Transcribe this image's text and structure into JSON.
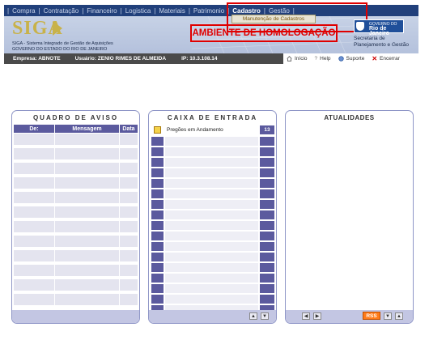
{
  "nav": {
    "items": [
      "Compra",
      "Contratação",
      "Financeiro",
      "Logistica",
      "Materiais",
      "Patrimonio",
      "Cadastro",
      "Gestão"
    ],
    "active_index": 6,
    "dropdown_item": "Manutenção de Cadastros"
  },
  "header": {
    "logo_text": "SIGA",
    "subtitle_line1": "SIGA - Sistema Integrado de Gestão de Aquisições",
    "subtitle_line2": "GOVERNO DO ESTADO DO RIO DE JANEIRO",
    "environment_banner": "AMBIENTE DE HOMOLOGAÇÃO",
    "gov_small": "GOVERNO DO",
    "gov_big": "Rio de Janeiro",
    "secretaria_line1": "Secretaria de",
    "secretaria_line2": "Planejamento e Gestão"
  },
  "userbar": {
    "empresa": "Empresa: ABNOTE",
    "usuario": "Usuário: ZENIO RIMES DE ALMEIDA",
    "ip": "IP: 10.3.108.14",
    "links": [
      "Início",
      "Help",
      "Suporte",
      "Encerrar"
    ]
  },
  "aviso": {
    "title": "QUADRO DE AVISO",
    "columns": [
      "De:",
      "Mensagem",
      "Data"
    ]
  },
  "caixa": {
    "title": "CAIXA DE ENTRADA",
    "first_item": "Pregões em Andamento",
    "first_count": "13"
  },
  "atualidades": {
    "title": "ATUALIDADES",
    "rss_label": "RSS"
  },
  "colors": {
    "nav_bg": "#21407b",
    "accent_purple": "#5b5a9e",
    "highlight_red": "#e00000",
    "rss_orange": "#ff7b1a"
  },
  "icons": [
    "home-icon",
    "help-icon",
    "support-icon",
    "close-icon",
    "folder-icon",
    "chevron-up-icon",
    "chevron-down-icon",
    "prev-icon",
    "next-icon"
  ]
}
